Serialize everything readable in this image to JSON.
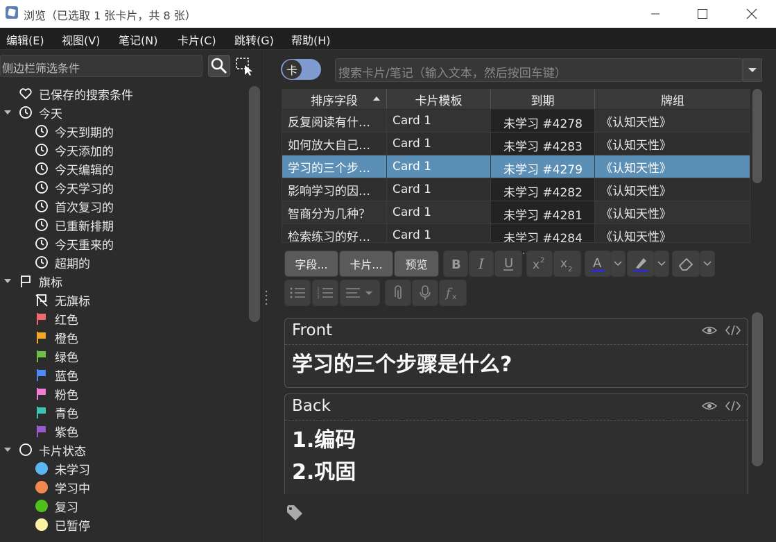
{
  "window": {
    "title": "浏览（已选取 1 张卡片，共 8 张）"
  },
  "menu": [
    "编辑(E)",
    "视图(V)",
    "笔记(N)",
    "卡片(C)",
    "跳转(G)",
    "帮助(H)"
  ],
  "sidebar": {
    "filter_placeholder": "侧边栏筛选条件",
    "items": [
      {
        "label": "已保存的搜索条件",
        "icon": "heart-icon",
        "level": 0
      },
      {
        "label": "今天",
        "icon": "clock-icon",
        "level": 0,
        "expanded": true
      },
      {
        "label": "今天到期的",
        "icon": "clock-icon",
        "level": 1
      },
      {
        "label": "今天添加的",
        "icon": "clock-icon",
        "level": 1
      },
      {
        "label": "今天编辑的",
        "icon": "clock-icon",
        "level": 1
      },
      {
        "label": "今天学习的",
        "icon": "clock-icon",
        "level": 1
      },
      {
        "label": "首次复习的",
        "icon": "clock-icon",
        "level": 1
      },
      {
        "label": "已重新排期",
        "icon": "clock-icon",
        "level": 1
      },
      {
        "label": "今天重来的",
        "icon": "clock-icon",
        "level": 1
      },
      {
        "label": "超期的",
        "icon": "clock-icon",
        "level": 1
      },
      {
        "label": "旗标",
        "icon": "flag-icon",
        "level": 0,
        "expanded": true
      },
      {
        "label": "无旗标",
        "icon": "no-flag-icon",
        "level": 1
      },
      {
        "label": "红色",
        "icon": "flag-icon",
        "color": "#f0696f",
        "level": 1
      },
      {
        "label": "橙色",
        "icon": "flag-icon",
        "color": "#f5a623",
        "level": 1
      },
      {
        "label": "绿色",
        "icon": "flag-icon",
        "color": "#6cc04a",
        "level": 1
      },
      {
        "label": "蓝色",
        "icon": "flag-icon",
        "color": "#4c8bf5",
        "level": 1
      },
      {
        "label": "粉色",
        "icon": "flag-icon",
        "color": "#f27bd4",
        "level": 1
      },
      {
        "label": "青色",
        "icon": "flag-icon",
        "color": "#3bc2b4",
        "level": 1
      },
      {
        "label": "紫色",
        "icon": "flag-icon",
        "color": "#9b59d0",
        "level": 1
      },
      {
        "label": "卡片状态",
        "icon": "circle-icon",
        "level": 0,
        "expanded": true
      },
      {
        "label": "未学习",
        "icon": "dot-icon",
        "color": "#5bb5f5",
        "level": 1
      },
      {
        "label": "学习中",
        "icon": "dot-icon",
        "color": "#f28a50",
        "level": 1
      },
      {
        "label": "复习",
        "icon": "dot-icon",
        "color": "#4fc01c",
        "level": 1
      },
      {
        "label": "已暂停",
        "icon": "dot-icon",
        "color": "#fbf3a3",
        "level": 1
      }
    ]
  },
  "toggle": {
    "label": "卡"
  },
  "search": {
    "placeholder": "搜索卡片/笔记（输入文本，然后按回车键）"
  },
  "table": {
    "columns": [
      "排序字段",
      "卡片模板",
      "到期",
      "牌组"
    ],
    "rows": [
      [
        "反复阅读有什…",
        "Card 1",
        "未学习 #4278",
        "《认知天性》"
      ],
      [
        "如何放大自己…",
        "Card 1",
        "未学习 #4283",
        "《认知天性》"
      ],
      [
        "学习的三个步…",
        "Card 1",
        "未学习 #4279",
        "《认知天性》"
      ],
      [
        "影响学习的因…",
        "Card 1",
        "未学习 #4282",
        "《认知天性》"
      ],
      [
        "智商分为几种？",
        "Card 1",
        "未学习 #4281",
        "《认知天性》"
      ],
      [
        "检索练习的好…",
        "Card 1",
        "未学习 #4284",
        "《认知天性》"
      ]
    ],
    "selected_row": 2,
    "selected_color": "#5b8fb5"
  },
  "editor": {
    "fields_button": "字段...",
    "cards_button": "卡片...",
    "preview_button": "预览",
    "text_color": "#2b2bd8",
    "highlight_color": "#2b2bd8",
    "fields": [
      {
        "name": "Front",
        "lines": [
          "学习的三个步骤是什么?"
        ]
      },
      {
        "name": "Back",
        "lines": [
          "1.编码",
          "2.巩固"
        ]
      }
    ]
  }
}
